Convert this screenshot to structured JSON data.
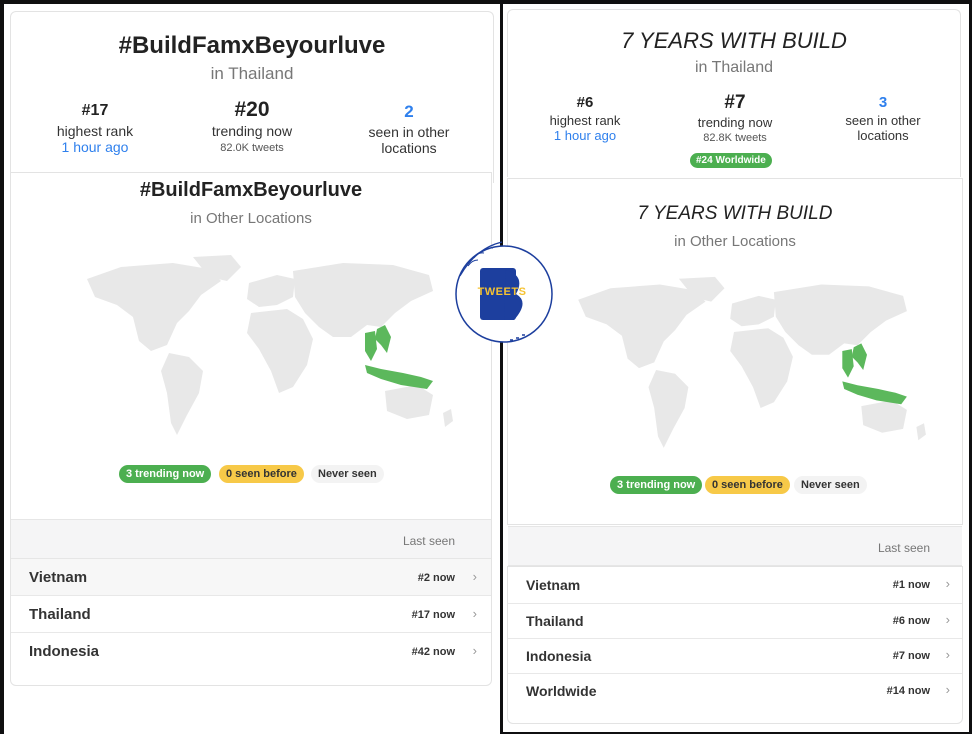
{
  "left": {
    "header": {
      "title": "#BuildFamxBeyourluve",
      "location": "in Thailand",
      "stats": [
        {
          "value": "#17",
          "label": "highest rank",
          "sub": "1 hour ago"
        },
        {
          "value": "#20",
          "label": "trending now",
          "sub": "82.0K tweets"
        },
        {
          "value": "2",
          "label": "seen in other locations"
        }
      ]
    },
    "other": {
      "title": "#BuildFamxBeyourluve",
      "subtitle": "in Other Locations",
      "legend": [
        "3 trending now",
        "0 seen before",
        "Never seen"
      ]
    },
    "last_seen_header": "Last seen",
    "rows": [
      {
        "name": "Vietnam",
        "rank": "#2 now"
      },
      {
        "name": "Thailand",
        "rank": "#17 now"
      },
      {
        "name": "Indonesia",
        "rank": "#42 now"
      }
    ]
  },
  "right": {
    "header": {
      "title": "7 YEARS WITH BUILD",
      "location": "in Thailand",
      "stats": [
        {
          "value": "#6",
          "label": "highest rank",
          "sub": "1 hour ago"
        },
        {
          "value": "#7",
          "label": "trending now",
          "sub": "82.8K tweets",
          "badge": "#24 Worldwide"
        },
        {
          "value": "3",
          "label": "seen in other locations"
        }
      ]
    },
    "other": {
      "title": "7 YEARS WITH BUILD",
      "subtitle": "in Other Locations",
      "legend": [
        "3 trending now",
        "0 seen before",
        "Never seen"
      ]
    },
    "last_seen_header": "Last seen",
    "rows": [
      {
        "name": "Vietnam",
        "rank": "#1 now"
      },
      {
        "name": "Thailand",
        "rank": "#6 now"
      },
      {
        "name": "Indonesia",
        "rank": "#7 now"
      },
      {
        "name": "Worldwide",
        "rank": "#14 now"
      }
    ]
  },
  "logo": {
    "letter": "B",
    "word": "TWEETS",
    "script": "build family"
  },
  "colors": {
    "accent_blue": "#2f80ed",
    "trending_green": "#4caf50",
    "seen_yellow": "#f7c948",
    "map_gray": "#e8e8e8"
  }
}
